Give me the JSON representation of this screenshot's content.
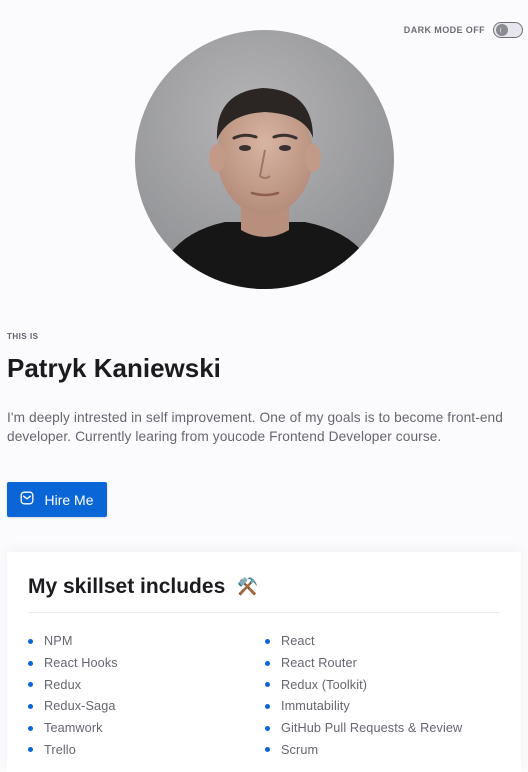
{
  "header": {
    "dark_mode_label": "DARK MODE OFF",
    "dark_mode_on": false
  },
  "profile": {
    "eyebrow": "THIS IS",
    "name": "Patryk Kaniewski",
    "bio": "I'm deeply intrested in self improvement. One of my goals is to become front-end developer. Currently learing from youcode Frontend Developer course.",
    "hire_label": "Hire Me",
    "hire_icon": "mail-icon"
  },
  "skills": {
    "title": "My skillset includes",
    "emoji": "⚒️",
    "items": [
      "NPM",
      "React",
      "React Hooks",
      "React Router",
      "Redux",
      "Redux (Toolkit)",
      "Redux-Saga",
      "Immutability",
      "Teamwork",
      "GitHub Pull Requests & Review",
      "Trello",
      "Scrum"
    ]
  },
  "colors": {
    "accent": "#0a66d6",
    "background": "#fbfbfe",
    "text": "#1b1b1f",
    "muted": "#666670"
  }
}
